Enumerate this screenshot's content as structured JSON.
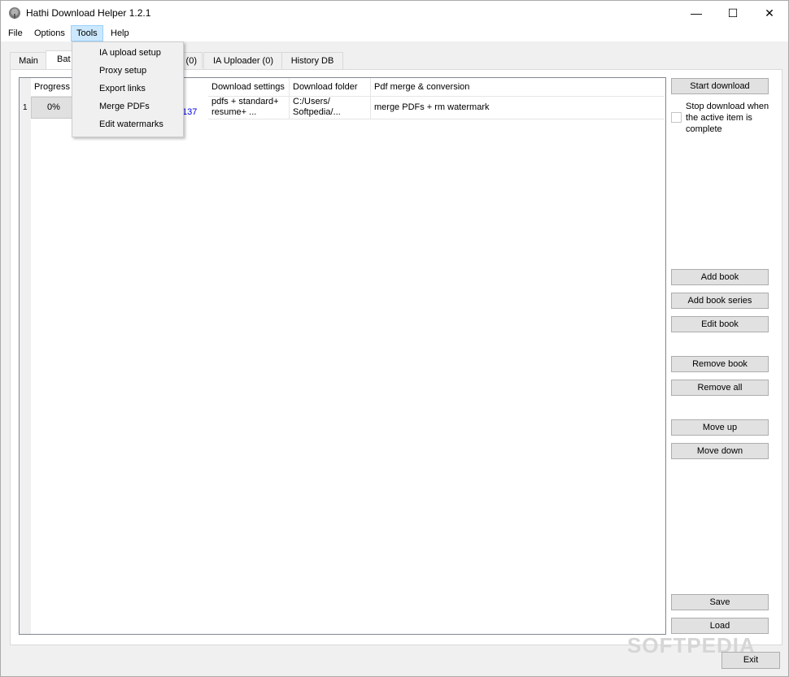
{
  "window": {
    "title": "Hathi Download Helper 1.2.1",
    "minimize": "—",
    "maximize": "☐",
    "close": "✕"
  },
  "menubar": {
    "file": "File",
    "options": "Options",
    "tools": "Tools",
    "help": "Help"
  },
  "tools_menu": {
    "items": [
      "IA upload setup",
      "Proxy setup",
      "Export links",
      "Merge PDFs",
      "Edit watermarks"
    ]
  },
  "tabs": {
    "main": "Main",
    "batch": "Bat",
    "hidden_tab": "(0)",
    "ia_uploader": "IA Uploader (0)",
    "history_db": "History DB"
  },
  "grid": {
    "headers": {
      "progress": "Progress",
      "download_settings": "Download settings",
      "download_folder": "Download folder",
      "pdf_merge": "Pdf merge & conversion"
    },
    "rows": [
      {
        "index": "1",
        "progress": "0%",
        "id_fragment": "137",
        "download_settings": "pdfs + standard+ resume+ ...",
        "download_folder": "C:/Users/ Softpedia/...",
        "pdf_merge": "merge PDFs + rm watermark"
      }
    ]
  },
  "sidebar": {
    "start_download": "Start download",
    "stop_when_complete_label": "Stop download when the active item is complete",
    "stop_when_complete_checked": false,
    "add_book": "Add book",
    "add_book_series": "Add book series",
    "edit_book": "Edit book",
    "remove_book": "Remove book",
    "remove_all": "Remove all",
    "move_up": "Move up",
    "move_down": "Move down",
    "save": "Save",
    "load": "Load"
  },
  "footer": {
    "exit": "Exit"
  },
  "watermark": "SOFTPEDIA",
  "colors": {
    "link": "#0000ee",
    "menu_highlight": "#cce8ff"
  }
}
